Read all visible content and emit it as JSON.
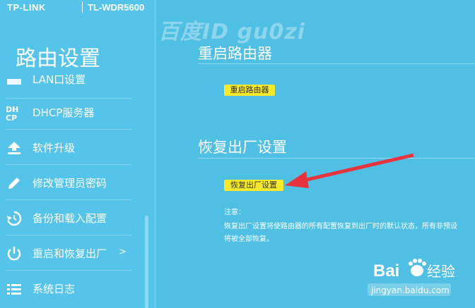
{
  "brand": {
    "logo": "TP-LINK",
    "model": "TL-WDR5600"
  },
  "sidebar": {
    "title": "路由设置",
    "items": [
      {
        "label": "LAN口设置",
        "icon": "lan-icon"
      },
      {
        "label": "DHCP服务器",
        "icon": "dhcp-icon",
        "icon_text": "DH\nCP"
      },
      {
        "label": "软件升级",
        "icon": "upload-icon"
      },
      {
        "label": "修改管理员密码",
        "icon": "pencil-icon"
      },
      {
        "label": "备份和载入配置",
        "icon": "history-icon"
      },
      {
        "label": "重启和恢复出厂",
        "icon": "power-icon",
        "chevron": ">"
      },
      {
        "label": "系统日志",
        "icon": "list-icon"
      }
    ]
  },
  "watermark": {
    "top_text": "百度ID gu0zi",
    "baidu_brand": "Bai",
    "baidu_brand_suffix": "经验",
    "baidu_url": "jingyan.baidu.com"
  },
  "main": {
    "restart": {
      "title": "重启路由器",
      "button_label": "重启路由器"
    },
    "factory": {
      "title": "恢复出厂设置",
      "button_label": "恢复出厂设置"
    },
    "note": {
      "heading": "注意：",
      "line1": "恢复出厂设置将使路由器的所有配置恢复到出厂时的默认状态，所有非预设",
      "line2": "将被全部恢复。"
    }
  },
  "colors": {
    "background": "#4fbfe4",
    "sidebar": "#54c4ea",
    "button": "#f5e92a",
    "arrow": "#e8323c"
  }
}
